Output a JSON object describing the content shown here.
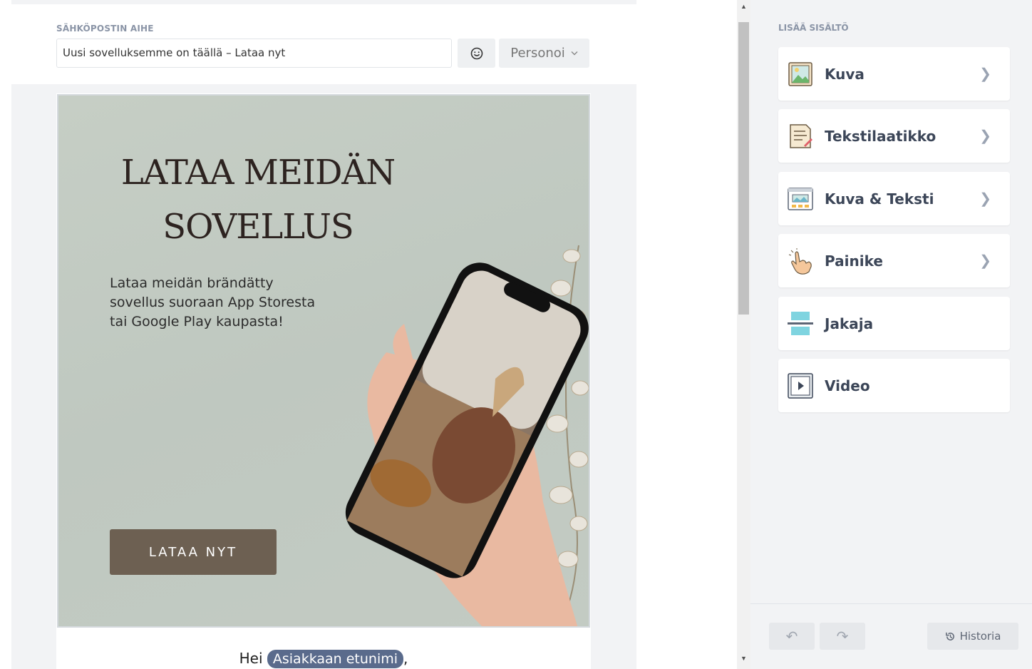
{
  "subject": {
    "label": "SÄHKÖPOSTIN AIHE",
    "value": "Uusi sovelluksemme on täällä – Lataa nyt",
    "emoji_icon": "smiley-icon",
    "personalize_label": "Personoi"
  },
  "hero": {
    "title_line1": "LATAA MEIDÄN",
    "title_line2": "SOVELLUS",
    "text_line1": "Lataa meidän brändätty",
    "text_line2": "sovellus suoraan App Storesta",
    "text_line3": "tai Google Play kaupasta!",
    "button_label": "LATAA NYT",
    "button_color": "#6d6052"
  },
  "greeting": {
    "prefix": "Hei",
    "merge_tag": "Asiakkaan etunimi",
    "suffix": ","
  },
  "panel": {
    "title": "LISÄÄ SISÄLTÖ",
    "blocks": [
      {
        "label": "Kuva",
        "icon": "image-icon"
      },
      {
        "label": "Tekstilaatikko",
        "icon": "text-document-icon"
      },
      {
        "label": "Kuva & Teksti",
        "icon": "image-text-icon"
      },
      {
        "label": "Painike",
        "icon": "pointer-hand-icon"
      },
      {
        "label": "Jakaja",
        "icon": "divider-icon"
      },
      {
        "label": "Video",
        "icon": "video-play-icon"
      }
    ],
    "history_label": "Historia"
  }
}
